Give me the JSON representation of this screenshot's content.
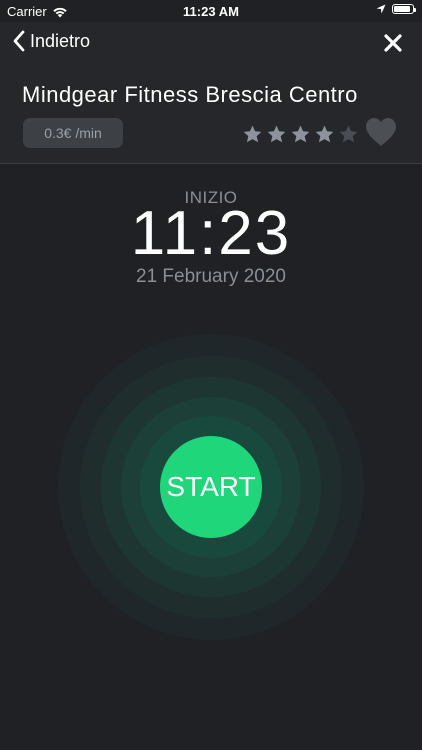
{
  "status_bar": {
    "carrier": "Carrier",
    "time": "11:23 AM",
    "battery_level": 0.9
  },
  "nav": {
    "back_label": "Indietro"
  },
  "gym": {
    "name": "Mindgear Fitness Brescia Centro",
    "price": "0.3€ /min",
    "rating": 4,
    "rating_max": 5
  },
  "session": {
    "start_label": "INIZIO",
    "start_time": "11:23",
    "start_date": "21 February 2020",
    "button_label": "START"
  },
  "colors": {
    "accent": "#1fd77a",
    "star_filled": "#8c939c",
    "star_empty": "#4a4e54",
    "background": "#1f2124"
  }
}
